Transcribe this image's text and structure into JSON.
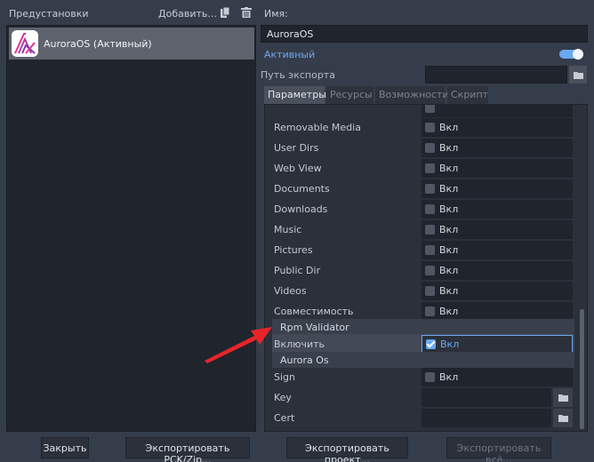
{
  "left": {
    "presets_label": "Предустановки",
    "add_label": "Добавить...",
    "preset": {
      "name": "AuroraOS (Активный)"
    }
  },
  "right": {
    "name_label": "Имя:",
    "name_value": "AuroraOS",
    "active_label": "Активный",
    "active_on": true,
    "export_path_label": "Путь экспорта",
    "export_path_value": ""
  },
  "tabs": [
    {
      "label": "Параметры",
      "active": true
    },
    {
      "label": "Ресурсы",
      "active": false
    },
    {
      "label": "Возможности",
      "active": false
    },
    {
      "label": "Скрипт",
      "active": false
    }
  ],
  "settings": {
    "rows": [
      {
        "label": "Removable Media",
        "text": "Вкл",
        "checked": false
      },
      {
        "label": "User Dirs",
        "text": "Вкл",
        "checked": false
      },
      {
        "label": "Web View",
        "text": "Вкл",
        "checked": false
      },
      {
        "label": "Documents",
        "text": "Вкл",
        "checked": false
      },
      {
        "label": "Downloads",
        "text": "Вкл",
        "checked": false
      },
      {
        "label": "Music",
        "text": "Вкл",
        "checked": false
      },
      {
        "label": "Pictures",
        "text": "Вкл",
        "checked": false
      },
      {
        "label": "Public Dir",
        "text": "Вкл",
        "checked": false
      },
      {
        "label": "Videos",
        "text": "Вкл",
        "checked": false
      },
      {
        "label": "Совместимость",
        "text": "Вкл",
        "checked": false
      }
    ],
    "rpm_section": "Rpm Validator",
    "rpm_enable": {
      "label": "Включить",
      "text": "Вкл",
      "checked": true
    },
    "aurora_section": "Aurora Os",
    "sign": {
      "label": "Sign",
      "text": "Вкл",
      "checked": false
    },
    "key_label": "Key",
    "cert_label": "Cert"
  },
  "buttons": {
    "close": "Закрыть",
    "export_pck": "Экспортировать PCK/Zip...",
    "export_project": "Экспортировать проект...",
    "export_all": "Экспортировать всё..."
  },
  "colors": {
    "accent": "#6aa8f2",
    "annotation_arrow": "#e8242a"
  }
}
